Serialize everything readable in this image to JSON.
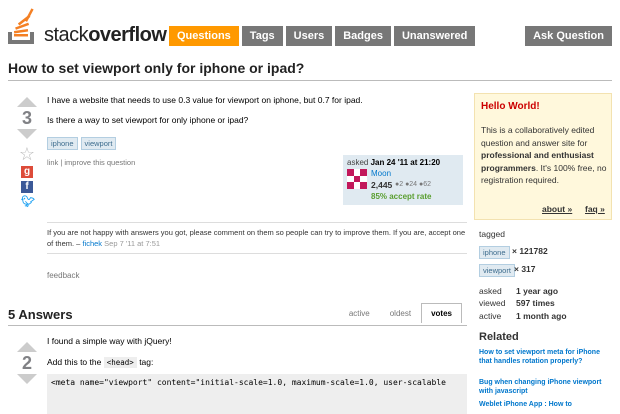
{
  "header": {
    "logo_text_light": "stack",
    "logo_text_bold": "overflow",
    "nav": [
      "Questions",
      "Tags",
      "Users",
      "Badges",
      "Unanswered"
    ],
    "ask_button": "Ask Question"
  },
  "question": {
    "title": "How to set viewport only for iphone or ipad?",
    "votes": "3",
    "body": [
      "I have a website that needs to use 0.3 value for viewport on iphone, but 0.7 for ipad.",
      "Is there a way to set viewport for only iphone or ipad?"
    ],
    "tags": [
      "iphone",
      "viewport"
    ],
    "links": "link | improve this question",
    "owner": {
      "asked_label": "asked",
      "asked_date": "Jan 24 '11 at 21:20",
      "user": "Moon",
      "rep": "2,445",
      "badges": "●2 ●24 ●62",
      "accept": "85% accept rate"
    },
    "comment": {
      "text": "If you are not happy with answers you got, please comment on them so people can try to improve them. If you are, accept one of them. –",
      "user": "fichek",
      "date": "Sep 7 '11 at 7:51"
    },
    "feedback": "feedback"
  },
  "answers": {
    "heading": "5 Answers",
    "tabs": [
      "active",
      "oldest",
      "votes"
    ],
    "first": {
      "votes": "2",
      "line1": "I found a simple way with jQuery!",
      "line2_pre": "Add this to the",
      "line2_code": "<head>",
      "line2_post": "tag:",
      "code": "<meta name=\"viewport\" content=\"initial-scale=1.0, maximum-scale=1.0, user-scalable"
    }
  },
  "sidebar": {
    "box_title": "Hello World!",
    "box_text_1": "This is a collaboratively edited question and answer site for ",
    "box_text_bold": "professional and enthusiast programmers",
    "box_text_2": ". It's 100% free, no registration required.",
    "about": "about »",
    "faq": "faq »",
    "tagged_label": "tagged",
    "tag_counts": [
      {
        "tag": "iphone",
        "count": "× 121782"
      },
      {
        "tag": "viewport",
        "count": "× 317"
      }
    ],
    "stats": [
      {
        "label": "asked",
        "value": "1 year ago"
      },
      {
        "label": "viewed",
        "value": "597 times"
      },
      {
        "label": "active",
        "value": "1 month ago"
      }
    ],
    "related_title": "Related",
    "related": [
      "How to set viewport meta for iPhone that handles rotation properly?",
      "Bug when changing iPhone viewport with javascript",
      "Weblet iPhone App : How to"
    ]
  }
}
